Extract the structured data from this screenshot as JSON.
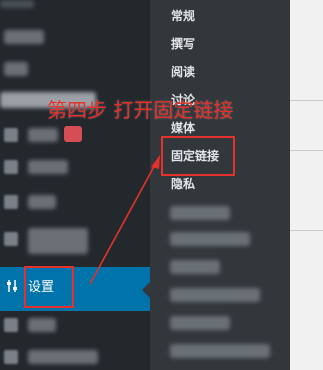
{
  "annotation": {
    "step_text": "第四步 打开固定链接",
    "color": "#e4312b"
  },
  "sidebar": {
    "settings": {
      "label": "设置",
      "icon": "settings-sliders-icon"
    }
  },
  "submenu": {
    "items": [
      {
        "label": "常规"
      },
      {
        "label": "撰写"
      },
      {
        "label": "阅读"
      },
      {
        "label": "讨论"
      },
      {
        "label": "媒体"
      },
      {
        "label": "固定链接"
      },
      {
        "label": "隐私"
      }
    ]
  },
  "colors": {
    "sidebar_bg": "#23282d",
    "submenu_bg": "#32373c",
    "active_bg": "#0073aa"
  }
}
